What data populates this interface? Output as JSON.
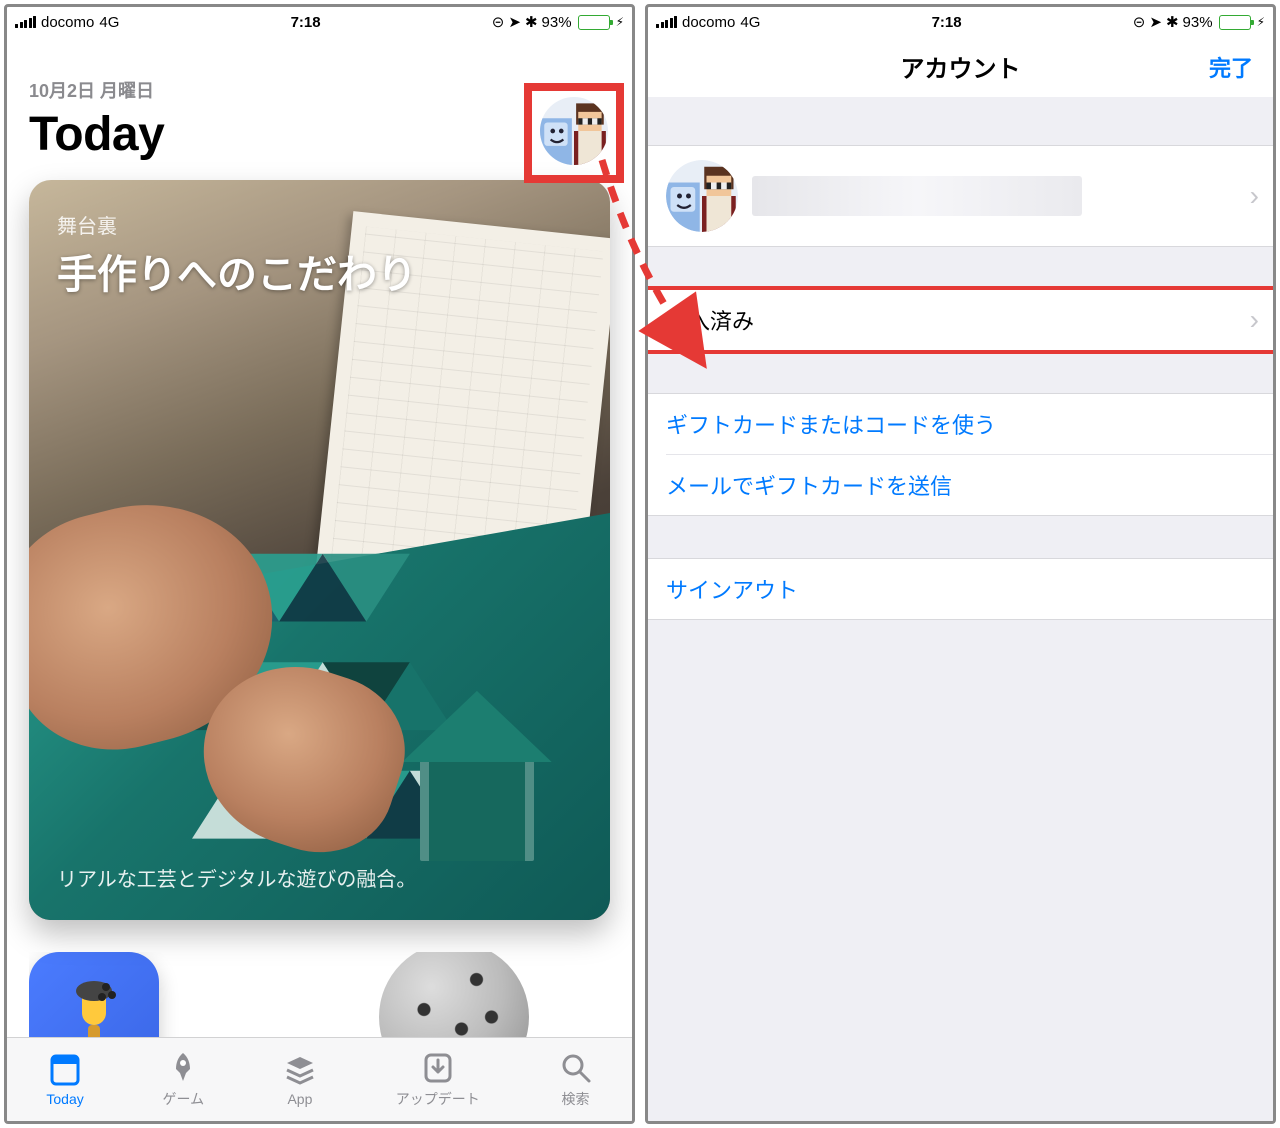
{
  "status": {
    "carrier": "docomo",
    "network": "4G",
    "time": "7:18",
    "battery_pct": "93%"
  },
  "left": {
    "date": "10月2日 月曜日",
    "heading": "Today",
    "card": {
      "eyebrow": "舞台裏",
      "headline": "手作りへのこだわり",
      "caption": "リアルな工芸とデジタルな遊びの融合。"
    },
    "tabs": {
      "today": "Today",
      "games": "ゲーム",
      "apps": "App",
      "updates": "アップデート",
      "search": "検索"
    }
  },
  "right": {
    "nav_title": "アカウント",
    "done": "完了",
    "purchased": "購入済み",
    "gift_redeem": "ギフトカードまたはコードを使う",
    "gift_send": "メールでギフトカードを送信",
    "signout": "サインアウト"
  }
}
